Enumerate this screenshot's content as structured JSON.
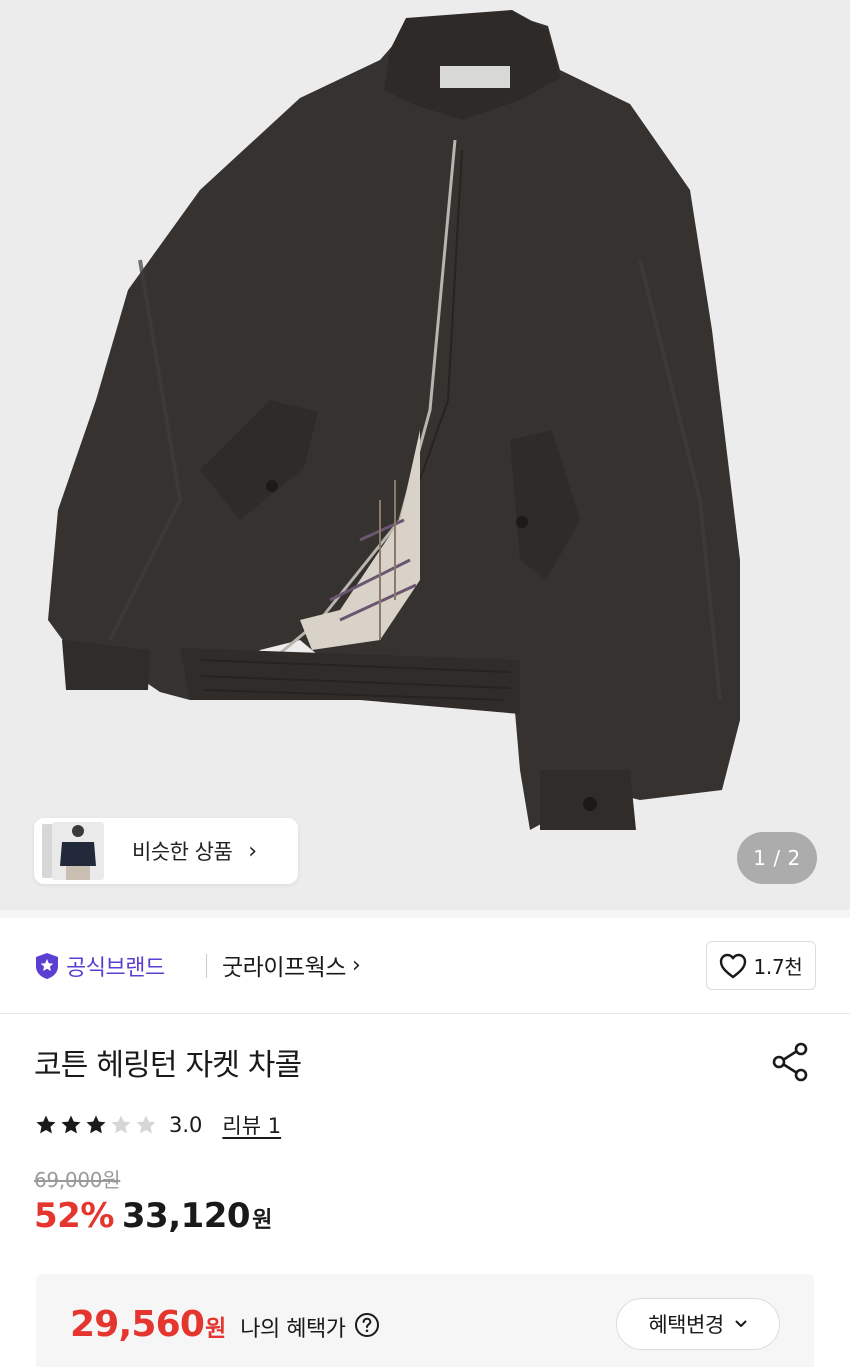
{
  "gallery": {
    "counter": "1 / 2",
    "similar_label": "비슷한 상품",
    "similar_chevron": "›",
    "image_subject": "dark charcoal zip-up harrington jacket with tartan lining",
    "colors": {
      "background": "#ececec",
      "jacket": "#353230",
      "lining": "#d9d2c8"
    }
  },
  "brand": {
    "official_label": "공식브랜드",
    "official_icon": "shield-star-icon",
    "name": "굿라이프웍스",
    "chevron": "›",
    "like_icon": "heart-outline-icon",
    "like_count": "1.7천",
    "colors": {
      "official": "#5b3fd1"
    }
  },
  "product": {
    "title": "코튼 헤링턴 자켓 차콜",
    "share_icon": "share-icon",
    "rating": {
      "stars_filled": 3,
      "stars_total": 5,
      "value": "3.0",
      "review_label": "리뷰 1"
    },
    "original_price": "69,000원",
    "discount": "52%",
    "sale_price": "33,120",
    "sale_unit": "원",
    "colors": {
      "discount": "#e5352f"
    }
  },
  "benefit": {
    "amount": "29,560",
    "unit": "원",
    "label": "나의 혜택가",
    "help_icon": "question-circle-icon",
    "change_label": "혜택변경",
    "change_icon": "chevron-down-icon"
  }
}
